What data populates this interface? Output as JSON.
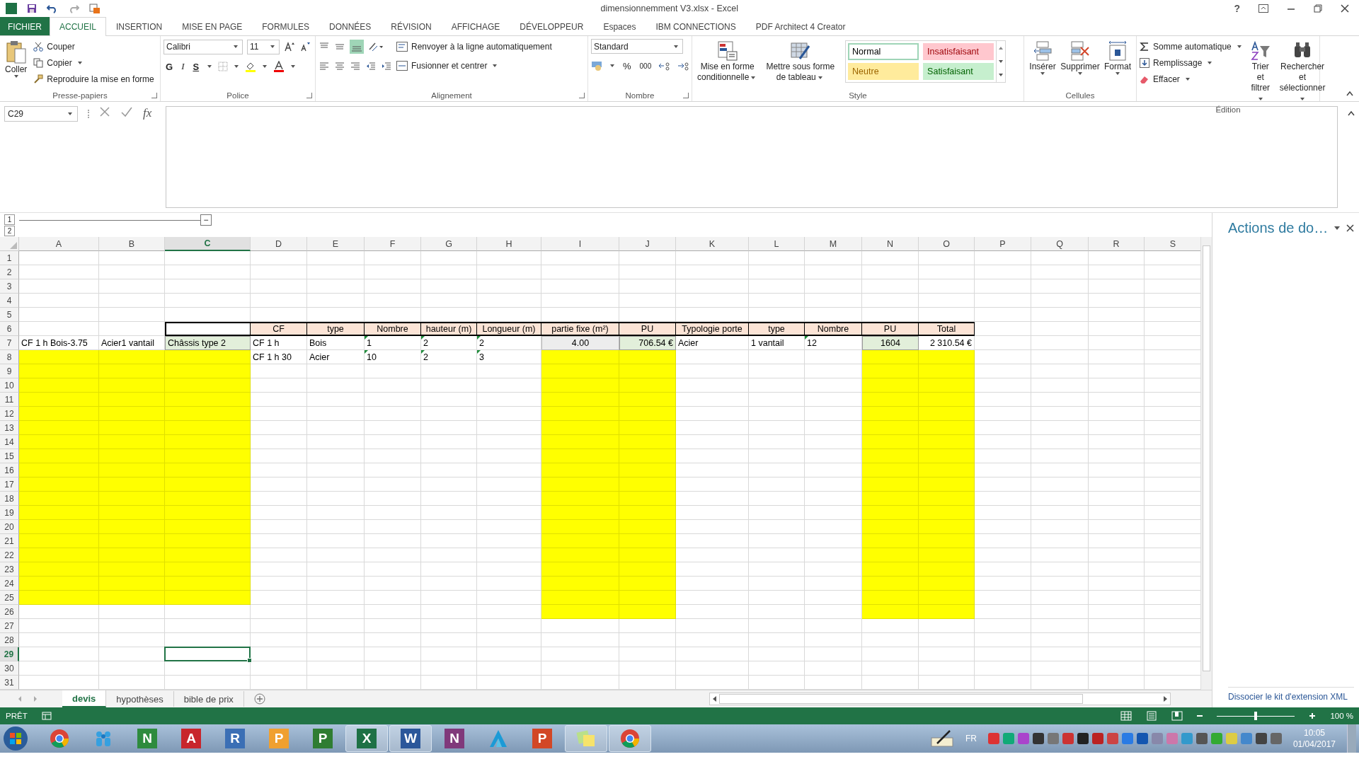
{
  "window": {
    "title": "dimensionnemment V3.xlsx - Excel",
    "help": "?"
  },
  "menu_tabs": [
    {
      "label": "FICHIER",
      "kind": "file",
      "selected": false
    },
    {
      "label": "ACCUEIL",
      "kind": "tab",
      "selected": true
    },
    {
      "label": "INSERTION",
      "kind": "tab",
      "selected": false
    },
    {
      "label": "MISE EN PAGE",
      "kind": "tab",
      "selected": false
    },
    {
      "label": "FORMULES",
      "kind": "tab",
      "selected": false
    },
    {
      "label": "DONNÉES",
      "kind": "tab",
      "selected": false
    },
    {
      "label": "RÉVISION",
      "kind": "tab",
      "selected": false
    },
    {
      "label": "AFFICHAGE",
      "kind": "tab",
      "selected": false
    },
    {
      "label": "DÉVELOPPEUR",
      "kind": "tab",
      "selected": false
    },
    {
      "label": "Espaces",
      "kind": "tab",
      "selected": false
    },
    {
      "label": "IBM CONNECTIONS",
      "kind": "tab",
      "selected": false
    },
    {
      "label": "PDF Architect 4 Creator",
      "kind": "tab",
      "selected": false
    }
  ],
  "clipboard": {
    "group": "Presse-papiers",
    "paste": "Coller",
    "cut": "Couper",
    "copy": "Copier",
    "format_painter": "Reproduire la mise en forme"
  },
  "font": {
    "group": "Police",
    "family": "Calibri",
    "size": "11",
    "bold": "G",
    "italic": "I",
    "underline": "S"
  },
  "alignment": {
    "group": "Alignement",
    "wrap": "Renvoyer à la ligne automatiquement",
    "merge": "Fusionner et centrer"
  },
  "number": {
    "group": "Nombre",
    "format": "Standard",
    "percent": "%",
    "thousands": "000"
  },
  "styles": {
    "group": "Style",
    "conditional": "Mise en forme\nconditionnelle",
    "table": "Mettre sous forme\nde tableau",
    "presets": [
      {
        "label": "Normal",
        "kind": "normal",
        "selected": true
      },
      {
        "label": "Insatisfaisant",
        "kind": "bad",
        "selected": false
      },
      {
        "label": "Neutre",
        "kind": "neutral",
        "selected": false
      },
      {
        "label": "Satisfaisant",
        "kind": "good",
        "selected": false
      }
    ]
  },
  "cells_group": {
    "group": "Cellules",
    "buttons": [
      {
        "label": "Insérer",
        "kind": "insert"
      },
      {
        "label": "Supprimer",
        "kind": "delete"
      },
      {
        "label": "Format",
        "kind": "format"
      }
    ]
  },
  "editing": {
    "group": "Édition",
    "autosum": "Somme automatique",
    "fill": "Remplissage",
    "clear": "Effacer",
    "sort": "Trier et\nfiltrer",
    "find": "Rechercher et\nsélectionner"
  },
  "formula_bar": {
    "name_box": "C29",
    "fx": "fx"
  },
  "outline": {
    "levels": [
      "1",
      "2"
    ],
    "collapse": "−"
  },
  "sheet": {
    "columns": [
      {
        "label": "A",
        "selected": false
      },
      {
        "label": "B",
        "selected": false
      },
      {
        "label": "C",
        "selected": true
      },
      {
        "label": "D",
        "selected": false
      },
      {
        "label": "E",
        "selected": false
      },
      {
        "label": "F",
        "selected": false
      },
      {
        "label": "G",
        "selected": false
      },
      {
        "label": "H",
        "selected": false
      },
      {
        "label": "I",
        "selected": false
      },
      {
        "label": "J",
        "selected": false
      },
      {
        "label": "K",
        "selected": false
      },
      {
        "label": "L",
        "selected": false
      },
      {
        "label": "M",
        "selected": false
      },
      {
        "label": "N",
        "selected": false
      },
      {
        "label": "O",
        "selected": false
      },
      {
        "label": "P",
        "selected": false
      },
      {
        "label": "Q",
        "selected": false
      },
      {
        "label": "R",
        "selected": false
      },
      {
        "label": "S",
        "selected": false
      }
    ],
    "rows": [
      {
        "label": "1",
        "selected": false
      },
      {
        "label": "2",
        "selected": false
      },
      {
        "label": "3",
        "selected": false
      },
      {
        "label": "4",
        "selected": false
      },
      {
        "label": "5",
        "selected": false
      },
      {
        "label": "6",
        "selected": false,
        "cells": {
          "C": {
            "kind": "frame"
          },
          "D": {
            "kind": "header",
            "text": "CF"
          },
          "E": {
            "kind": "header",
            "text": "type"
          },
          "F": {
            "kind": "header",
            "text": "Nombre"
          },
          "G": {
            "kind": "header",
            "text": "hauteur (m)"
          },
          "H": {
            "kind": "header",
            "text": "Longueur (m)"
          },
          "I": {
            "kind": "header",
            "text": "partie fixe (m²)"
          },
          "J": {
            "kind": "header",
            "text": "PU"
          },
          "K": {
            "kind": "header",
            "text": "Typologie porte"
          },
          "L": {
            "kind": "header",
            "text": "type"
          },
          "M": {
            "kind": "header",
            "text": "Nombre"
          },
          "N": {
            "kind": "header",
            "text": "PU"
          },
          "O": {
            "kind": "header",
            "text": "Total"
          }
        }
      },
      {
        "label": "7",
        "selected": false,
        "cells": {
          "A": {
            "kind": "text",
            "text": "CF 1 h Bois-3.75",
            "marker": false
          },
          "B": {
            "kind": "text",
            "text": "Acier1 vantail",
            "marker": false
          },
          "C": {
            "kind": "label-green",
            "text": "Châssis type 2",
            "marker": false
          },
          "D": {
            "kind": "text",
            "text": "CF 1 h",
            "marker": false
          },
          "E": {
            "kind": "text",
            "text": "Bois",
            "marker": false
          },
          "F": {
            "kind": "text",
            "text": "1",
            "marker": true
          },
          "G": {
            "kind": "text",
            "text": "2",
            "marker": true
          },
          "H": {
            "kind": "text",
            "text": "2",
            "marker": true
          },
          "I": {
            "kind": "area",
            "text": "4.00",
            "marker": false
          },
          "J": {
            "kind": "unit-price",
            "text": "706.54 €",
            "marker": false
          },
          "K": {
            "kind": "text",
            "text": "Acier",
            "marker": false
          },
          "L": {
            "kind": "text",
            "text": "1 vantail",
            "marker": false
          },
          "M": {
            "kind": "text",
            "text": "12",
            "marker": true
          },
          "N": {
            "kind": "count-green",
            "text": "1604",
            "marker": false
          },
          "O": {
            "kind": "total",
            "text": "2 310.54 €",
            "marker": false
          }
        }
      },
      {
        "label": "8",
        "selected": false,
        "cells": {
          "A": {
            "kind": "blank",
            "color": "#ffff00"
          },
          "B": {
            "kind": "blank",
            "color": "#ffff00"
          },
          "C": {
            "kind": "blank",
            "color": "#ffff00"
          },
          "D": {
            "kind": "text",
            "text": "CF 1 h 30",
            "marker": false
          },
          "E": {
            "kind": "text",
            "text": "Acier",
            "marker": false
          },
          "F": {
            "kind": "text",
            "text": "10",
            "marker": true
          },
          "G": {
            "kind": "text",
            "text": "2",
            "marker": true
          },
          "H": {
            "kind": "text",
            "text": "3",
            "marker": true
          },
          "I": {
            "kind": "blank",
            "color": "#ffff00"
          },
          "J": {
            "kind": "blank",
            "color": "#ffff00"
          },
          "N": {
            "kind": "blank",
            "color": "#ffff00"
          },
          "O": {
            "kind": "blank",
            "color": "#ffff00"
          }
        }
      },
      {
        "label": "9",
        "selected": false,
        "cells": {
          "A": {
            "kind": "blank",
            "color": "#ffff00"
          },
          "B": {
            "kind": "blank",
            "color": "#ffff00"
          },
          "C": {
            "kind": "blank",
            "color": "#ffff00"
          },
          "I": {
            "kind": "blank",
            "color": "#ffff00"
          },
          "J": {
            "kind": "blank",
            "color": "#ffff00"
          },
          "N": {
            "kind": "blank",
            "color": "#ffff00"
          },
          "O": {
            "kind": "blank",
            "color": "#ffff00"
          }
        }
      },
      {
        "label": "10",
        "selected": false,
        "cells": {
          "A": {
            "kind": "blank",
            "color": "#ffff00"
          },
          "B": {
            "kind": "blank",
            "color": "#ffff00"
          },
          "C": {
            "kind": "blank",
            "color": "#ffff00"
          },
          "I": {
            "kind": "blank",
            "color": "#ffff00"
          },
          "J": {
            "kind": "blank",
            "color": "#ffff00"
          },
          "N": {
            "kind": "blank",
            "color": "#ffff00"
          },
          "O": {
            "kind": "blank",
            "color": "#ffff00"
          }
        }
      },
      {
        "label": "11",
        "selected": false,
        "cells": {
          "A": {
            "kind": "blank",
            "color": "#ffff00"
          },
          "B": {
            "kind": "blank",
            "color": "#ffff00"
          },
          "C": {
            "kind": "blank",
            "color": "#ffff00"
          },
          "I": {
            "kind": "blank",
            "color": "#ffff00"
          },
          "J": {
            "kind": "blank",
            "color": "#ffff00"
          },
          "N": {
            "kind": "blank",
            "color": "#ffff00"
          },
          "O": {
            "kind": "blank",
            "color": "#ffff00"
          }
        }
      },
      {
        "label": "12",
        "selected": false,
        "cells": {
          "A": {
            "kind": "blank",
            "color": "#ffff00"
          },
          "B": {
            "kind": "blank",
            "color": "#ffff00"
          },
          "C": {
            "kind": "blank",
            "color": "#ffff00"
          },
          "I": {
            "kind": "blank",
            "color": "#ffff00"
          },
          "J": {
            "kind": "blank",
            "color": "#ffff00"
          },
          "N": {
            "kind": "blank",
            "color": "#ffff00"
          },
          "O": {
            "kind": "blank",
            "color": "#ffff00"
          }
        }
      },
      {
        "label": "13",
        "selected": false,
        "cells": {
          "A": {
            "kind": "blank",
            "color": "#ffff00"
          },
          "B": {
            "kind": "blank",
            "color": "#ffff00"
          },
          "C": {
            "kind": "blank",
            "color": "#ffff00"
          },
          "I": {
            "kind": "blank",
            "color": "#ffff00"
          },
          "J": {
            "kind": "blank",
            "color": "#ffff00"
          },
          "N": {
            "kind": "blank",
            "color": "#ffff00"
          },
          "O": {
            "kind": "blank",
            "color": "#ffff00"
          }
        }
      },
      {
        "label": "14",
        "selected": false,
        "cells": {
          "A": {
            "kind": "blank",
            "color": "#ffff00"
          },
          "B": {
            "kind": "blank",
            "color": "#ffff00"
          },
          "C": {
            "kind": "blank",
            "color": "#ffff00"
          },
          "I": {
            "kind": "blank",
            "color": "#ffff00"
          },
          "J": {
            "kind": "blank",
            "color": "#ffff00"
          },
          "N": {
            "kind": "blank",
            "color": "#ffff00"
          },
          "O": {
            "kind": "blank",
            "color": "#ffff00"
          }
        }
      },
      {
        "label": "15",
        "selected": false,
        "cells": {
          "A": {
            "kind": "blank",
            "color": "#ffff00"
          },
          "B": {
            "kind": "blank",
            "color": "#ffff00"
          },
          "C": {
            "kind": "blank",
            "color": "#ffff00"
          },
          "I": {
            "kind": "blank",
            "color": "#ffff00"
          },
          "J": {
            "kind": "blank",
            "color": "#ffff00"
          },
          "N": {
            "kind": "blank",
            "color": "#ffff00"
          },
          "O": {
            "kind": "blank",
            "color": "#ffff00"
          }
        }
      },
      {
        "label": "16",
        "selected": false,
        "cells": {
          "A": {
            "kind": "blank",
            "color": "#ffff00"
          },
          "B": {
            "kind": "blank",
            "color": "#ffff00"
          },
          "C": {
            "kind": "blank",
            "color": "#ffff00"
          },
          "I": {
            "kind": "blank",
            "color": "#ffff00"
          },
          "J": {
            "kind": "blank",
            "color": "#ffff00"
          },
          "N": {
            "kind": "blank",
            "color": "#ffff00"
          },
          "O": {
            "kind": "blank",
            "color": "#ffff00"
          }
        }
      },
      {
        "label": "17",
        "selected": false,
        "cells": {
          "A": {
            "kind": "blank",
            "color": "#ffff00"
          },
          "B": {
            "kind": "blank",
            "color": "#ffff00"
          },
          "C": {
            "kind": "blank",
            "color": "#ffff00"
          },
          "I": {
            "kind": "blank",
            "color": "#ffff00"
          },
          "J": {
            "kind": "blank",
            "color": "#ffff00"
          },
          "N": {
            "kind": "blank",
            "color": "#ffff00"
          },
          "O": {
            "kind": "blank",
            "color": "#ffff00"
          }
        }
      },
      {
        "label": "18",
        "selected": false,
        "cells": {
          "A": {
            "kind": "blank",
            "color": "#ffff00"
          },
          "B": {
            "kind": "blank",
            "color": "#ffff00"
          },
          "C": {
            "kind": "blank",
            "color": "#ffff00"
          },
          "I": {
            "kind": "blank",
            "color": "#ffff00"
          },
          "J": {
            "kind": "blank",
            "color": "#ffff00"
          },
          "N": {
            "kind": "blank",
            "color": "#ffff00"
          },
          "O": {
            "kind": "blank",
            "color": "#ffff00"
          }
        }
      },
      {
        "label": "19",
        "selected": false,
        "cells": {
          "A": {
            "kind": "blank",
            "color": "#ffff00"
          },
          "B": {
            "kind": "blank",
            "color": "#ffff00"
          },
          "C": {
            "kind": "blank",
            "color": "#ffff00"
          },
          "I": {
            "kind": "blank",
            "color": "#ffff00"
          },
          "J": {
            "kind": "blank",
            "color": "#ffff00"
          },
          "N": {
            "kind": "blank",
            "color": "#ffff00"
          },
          "O": {
            "kind": "blank",
            "color": "#ffff00"
          }
        }
      },
      {
        "label": "20",
        "selected": false,
        "cells": {
          "A": {
            "kind": "blank",
            "color": "#ffff00"
          },
          "B": {
            "kind": "blank",
            "color": "#ffff00"
          },
          "C": {
            "kind": "blank",
            "color": "#ffff00"
          },
          "I": {
            "kind": "blank",
            "color": "#ffff00"
          },
          "J": {
            "kind": "blank",
            "color": "#ffff00"
          },
          "N": {
            "kind": "blank",
            "color": "#ffff00"
          },
          "O": {
            "kind": "blank",
            "color": "#ffff00"
          }
        }
      },
      {
        "label": "21",
        "selected": false,
        "cells": {
          "A": {
            "kind": "blank",
            "color": "#ffff00"
          },
          "B": {
            "kind": "blank",
            "color": "#ffff00"
          },
          "C": {
            "kind": "blank",
            "color": "#ffff00"
          },
          "I": {
            "kind": "blank",
            "color": "#ffff00"
          },
          "J": {
            "kind": "blank",
            "color": "#ffff00"
          },
          "N": {
            "kind": "blank",
            "color": "#ffff00"
          },
          "O": {
            "kind": "blank",
            "color": "#ffff00"
          }
        }
      },
      {
        "label": "22",
        "selected": false,
        "cells": {
          "A": {
            "kind": "blank",
            "color": "#ffff00"
          },
          "B": {
            "kind": "blank",
            "color": "#ffff00"
          },
          "C": {
            "kind": "blank",
            "color": "#ffff00"
          },
          "I": {
            "kind": "blank",
            "color": "#ffff00"
          },
          "J": {
            "kind": "blank",
            "color": "#ffff00"
          },
          "N": {
            "kind": "blank",
            "color": "#ffff00"
          },
          "O": {
            "kind": "blank",
            "color": "#ffff00"
          }
        }
      },
      {
        "label": "23",
        "selected": false,
        "cells": {
          "A": {
            "kind": "blank",
            "color": "#ffff00"
          },
          "B": {
            "kind": "blank",
            "color": "#ffff00"
          },
          "C": {
            "kind": "blank",
            "color": "#ffff00"
          },
          "I": {
            "kind": "blank",
            "color": "#ffff00"
          },
          "J": {
            "kind": "blank",
            "color": "#ffff00"
          },
          "N": {
            "kind": "blank",
            "color": "#ffff00"
          },
          "O": {
            "kind": "blank",
            "color": "#ffff00"
          }
        }
      },
      {
        "label": "24",
        "selected": false,
        "cells": {
          "A": {
            "kind": "blank",
            "color": "#ffff00"
          },
          "B": {
            "kind": "blank",
            "color": "#ffff00"
          },
          "C": {
            "kind": "blank",
            "color": "#ffff00"
          },
          "I": {
            "kind": "blank",
            "color": "#ffff00"
          },
          "J": {
            "kind": "blank",
            "color": "#ffff00"
          },
          "N": {
            "kind": "blank",
            "color": "#ffff00"
          },
          "O": {
            "kind": "blank",
            "color": "#ffff00"
          }
        }
      },
      {
        "label": "25",
        "selected": false,
        "cells": {
          "A": {
            "kind": "blank",
            "color": "#ffff00"
          },
          "B": {
            "kind": "blank",
            "color": "#ffff00"
          },
          "C": {
            "kind": "blank",
            "color": "#ffff00"
          },
          "I": {
            "kind": "blank",
            "color": "#ffff00"
          },
          "J": {
            "kind": "blank",
            "color": "#ffff00"
          },
          "N": {
            "kind": "blank",
            "color": "#ffff00"
          },
          "O": {
            "kind": "blank",
            "color": "#ffff00"
          }
        }
      },
      {
        "label": "26",
        "selected": false,
        "cells": {
          "I": {
            "kind": "blank",
            "color": "#ffff00"
          },
          "J": {
            "kind": "blank",
            "color": "#ffff00"
          },
          "N": {
            "kind": "blank",
            "color": "#ffff00"
          },
          "O": {
            "kind": "blank",
            "color": "#ffff00"
          }
        }
      },
      {
        "label": "27",
        "selected": false
      },
      {
        "label": "28",
        "selected": false
      },
      {
        "label": "29",
        "selected": true
      },
      {
        "label": "30",
        "selected": false
      },
      {
        "label": "31",
        "selected": false
      }
    ]
  },
  "sheet_tabs": [
    {
      "label": "devis",
      "selected": true
    },
    {
      "label": "hypothèses",
      "selected": false
    },
    {
      "label": "bible de prix",
      "selected": false
    }
  ],
  "status_bar": {
    "mode": "PRÊT",
    "zoom": "100 %",
    "level": 0.5
  },
  "task_pane": {
    "title": "Actions de do…",
    "link": "Dissocier le kit d'extension XML"
  },
  "taskbar": {
    "apps": [
      {
        "kind": "chrome",
        "open": false
      },
      {
        "kind": "people",
        "open": false
      },
      {
        "kind": "letter",
        "glyph": "N",
        "color": "#2e8b3e",
        "open": false
      },
      {
        "kind": "letter",
        "glyph": "A",
        "color": "#c8262c",
        "open": false
      },
      {
        "kind": "letter",
        "glyph": "R",
        "color": "#3b6fb5",
        "open": false
      },
      {
        "kind": "letter",
        "glyph": "P",
        "color": "#f0a030",
        "open": false
      },
      {
        "kind": "letter",
        "glyph": "P",
        "color": "#2f7d32",
        "open": false
      },
      {
        "kind": "letter",
        "glyph": "X",
        "color": "#1e7145",
        "open": true
      },
      {
        "kind": "letter",
        "glyph": "W",
        "color": "#2b579a",
        "open": true
      },
      {
        "kind": "letter",
        "glyph": "N",
        "color": "#80397b",
        "open": false
      },
      {
        "kind": "triangle",
        "open": false
      },
      {
        "kind": "letter",
        "glyph": "P",
        "color": "#d24726",
        "open": false
      },
      {
        "kind": "notes",
        "open": true
      },
      {
        "kind": "chrome",
        "open": true
      }
    ],
    "language": "FR",
    "time": "10:05",
    "date": "01/04/2017"
  }
}
